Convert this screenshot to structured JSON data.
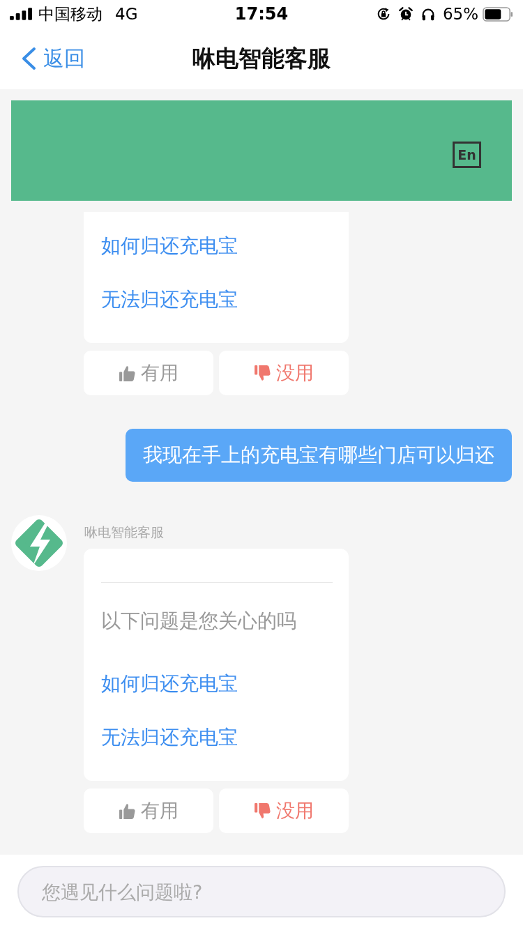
{
  "status_bar": {
    "carrier": "中国移动",
    "network": "4G",
    "time": "17:54",
    "battery": "65%"
  },
  "nav_bar": {
    "back_label": "返回",
    "title": "咻电智能客服"
  },
  "banner": {
    "language_button": "En"
  },
  "messages": [
    {
      "kind": "bot",
      "cut_off_top": true,
      "links": [
        "如何归还充电宝",
        "无法归还充电宝"
      ],
      "feedback": [
        {
          "kind": "like",
          "label": "有用"
        },
        {
          "kind": "dislike",
          "label": "没用"
        }
      ]
    },
    {
      "kind": "user",
      "text": "我现在手上的充电宝有哪些门店可以归还"
    },
    {
      "kind": "bot",
      "cut_off_top": false,
      "sender": "咻电智能客服",
      "prompt": "以下问题是您关心的吗",
      "links": [
        "如何归还充电宝",
        "无法归还充电宝"
      ],
      "feedback": [
        {
          "kind": "like",
          "label": "有用"
        },
        {
          "kind": "dislike",
          "label": "没用"
        }
      ]
    }
  ],
  "input_bar": {
    "placeholder": "您遇见什么问题啦?"
  }
}
